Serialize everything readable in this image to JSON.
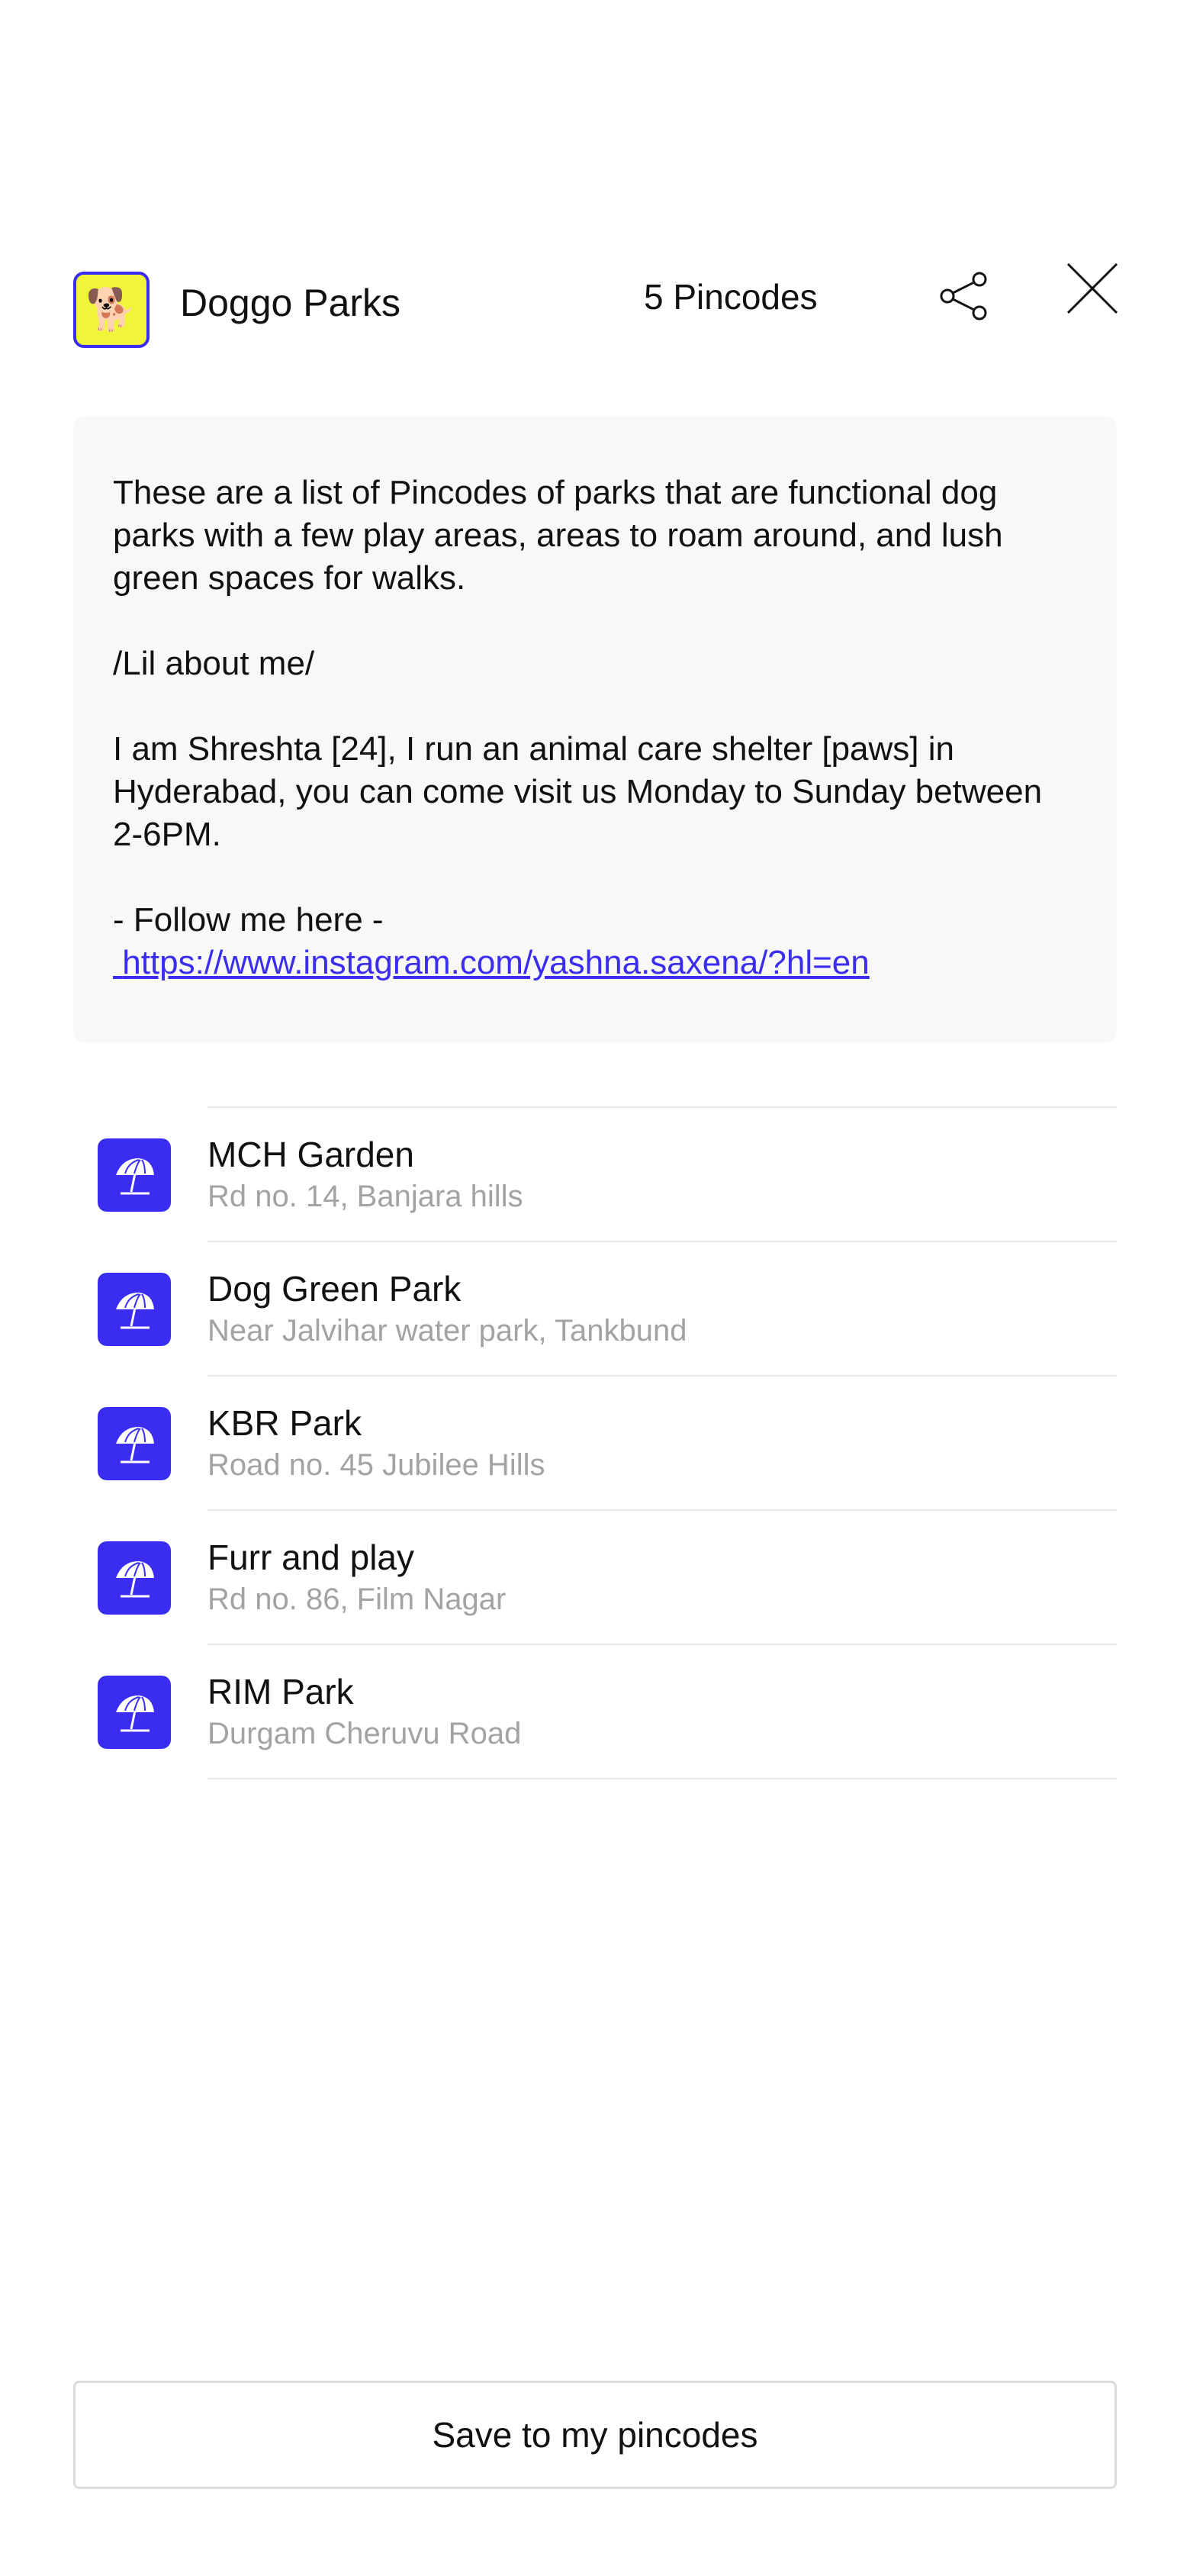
{
  "header": {
    "app_icon": "dog-emoji",
    "app_icon_glyph": "🐕",
    "title": "Doggo Parks",
    "pincode_count": "5 Pincodes",
    "share_icon": "share-icon",
    "close_icon": "close-icon"
  },
  "description": {
    "intro_lines": [
      "These are a list of Pincodes of parks that are functional dog",
      "parks with a few play areas, areas to roam around, and lush",
      "green spaces for walks."
    ],
    "about_heading": "/Lil about me/",
    "bio_lines": [
      "I am Shreshta [24], I run an animal care shelter [paws] in",
      "Hyderabad, you can come visit us Monday to Sunday between",
      "2-6PM."
    ],
    "follow_label": "- Follow me here -",
    "link": " https://www.instagram.com/yashna.saxena/?hl=en"
  },
  "parks": [
    {
      "name": "MCH Garden",
      "address": "Rd no. 14, Banjara hills",
      "icon": "beach-umbrella-icon"
    },
    {
      "name": "Dog Green Park",
      "address": "Near Jalvihar water park, Tankbund",
      "icon": "beach-umbrella-icon"
    },
    {
      "name": "KBR Park",
      "address": "Road no. 45 Jubilee Hills",
      "icon": "beach-umbrella-icon"
    },
    {
      "name": "Furr and play",
      "address": "Rd no. 86, Film Nagar",
      "icon": "beach-umbrella-icon"
    },
    {
      "name": "RIM Park",
      "address": "Durgam Cheruvu Road",
      "icon": "beach-umbrella-icon"
    }
  ],
  "actions": {
    "save_label": "Save to my pincodes"
  },
  "colors": {
    "accent": "#3a2cf0",
    "app_icon_bg": "#f1f53a",
    "card_bg": "#f8f8f6",
    "secondary_text": "#a3a3a3"
  }
}
